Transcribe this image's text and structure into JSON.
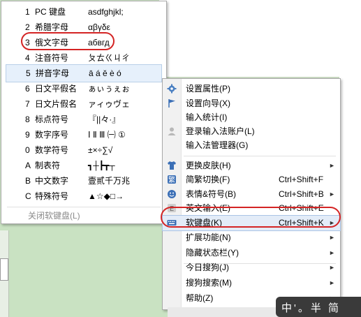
{
  "soft_keyboard_menu": {
    "items": [
      {
        "key": "1",
        "label": "PC 键盘",
        "sample": "asdfghjkl;"
      },
      {
        "key": "2",
        "label": "希腊字母",
        "sample": "αβγδε"
      },
      {
        "key": "3",
        "label": "俄文字母",
        "sample": "абвгд"
      },
      {
        "key": "4",
        "label": "注音符号",
        "sample": "ㄆㄊㄍㄐㄔ"
      },
      {
        "key": "5",
        "label": "拼音字母",
        "sample": "ā á ě è ó"
      },
      {
        "key": "6",
        "label": "日文平假名",
        "sample": "ぁぃぅぇぉ"
      },
      {
        "key": "7",
        "label": "日文片假名",
        "sample": "ァィゥヴェ"
      },
      {
        "key": "8",
        "label": "标点符号",
        "sample": "『||々·』"
      },
      {
        "key": "9",
        "label": "数字序号",
        "sample": "Ⅰ Ⅱ Ⅲ ㈠ ①"
      },
      {
        "key": "0",
        "label": "数学符号",
        "sample": "±×÷∑√"
      },
      {
        "key": "A",
        "label": "制表符",
        "sample": "┓┼┣┳┬"
      },
      {
        "key": "B",
        "label": "中文数字",
        "sample": "壹贰千万兆"
      },
      {
        "key": "C",
        "label": "特殊符号",
        "sample": "▲☆◆□→"
      }
    ],
    "close_label": "关闭软键盘(L)"
  },
  "context_menu": {
    "items": [
      {
        "label": "设置属性(P)",
        "icon": "gear-icon"
      },
      {
        "label": "设置向导(X)",
        "icon": "flag-icon"
      },
      {
        "label": "输入统计(I)",
        "icon": ""
      },
      {
        "label": "登录输入法账户(L)",
        "icon": "user-icon"
      },
      {
        "label": "输入法管理器(G)",
        "icon": ""
      },
      {
        "label": "更换皮肤(H)",
        "icon": "shirt-icon",
        "arrow": "►"
      },
      {
        "label": "简繁切换(F)",
        "icon": "trad-simp-icon",
        "shortcut": "Ctrl+Shift+F"
      },
      {
        "label": "表情&符号(B)",
        "icon": "smiley-icon",
        "shortcut": "Ctrl+Shift+B",
        "arrow": "►"
      },
      {
        "label": "英文输入(E)",
        "icon": "english-icon",
        "shortcut": "Ctrl+Shift+E"
      },
      {
        "label": "软键盘(K)",
        "icon": "keyboard-icon",
        "shortcut": "Ctrl+Shift+K",
        "arrow": "►"
      },
      {
        "label": "扩展功能(N)",
        "icon": "",
        "arrow": "►"
      },
      {
        "label": "隐藏状态栏(Y)",
        "icon": "",
        "arrow": "►"
      },
      {
        "label": "今日搜狗(J)",
        "icon": "",
        "arrow": "►"
      },
      {
        "label": "搜狗搜索(M)",
        "icon": "",
        "arrow": "►"
      },
      {
        "label": "帮助(Z)",
        "icon": "",
        "arrow": "►"
      }
    ]
  },
  "ime_bar": {
    "text": "中'。半 简"
  },
  "colors": {
    "highlight": "#e3ecf8",
    "annotation": "#d42424",
    "ime_bg": "#3a3a3a"
  }
}
